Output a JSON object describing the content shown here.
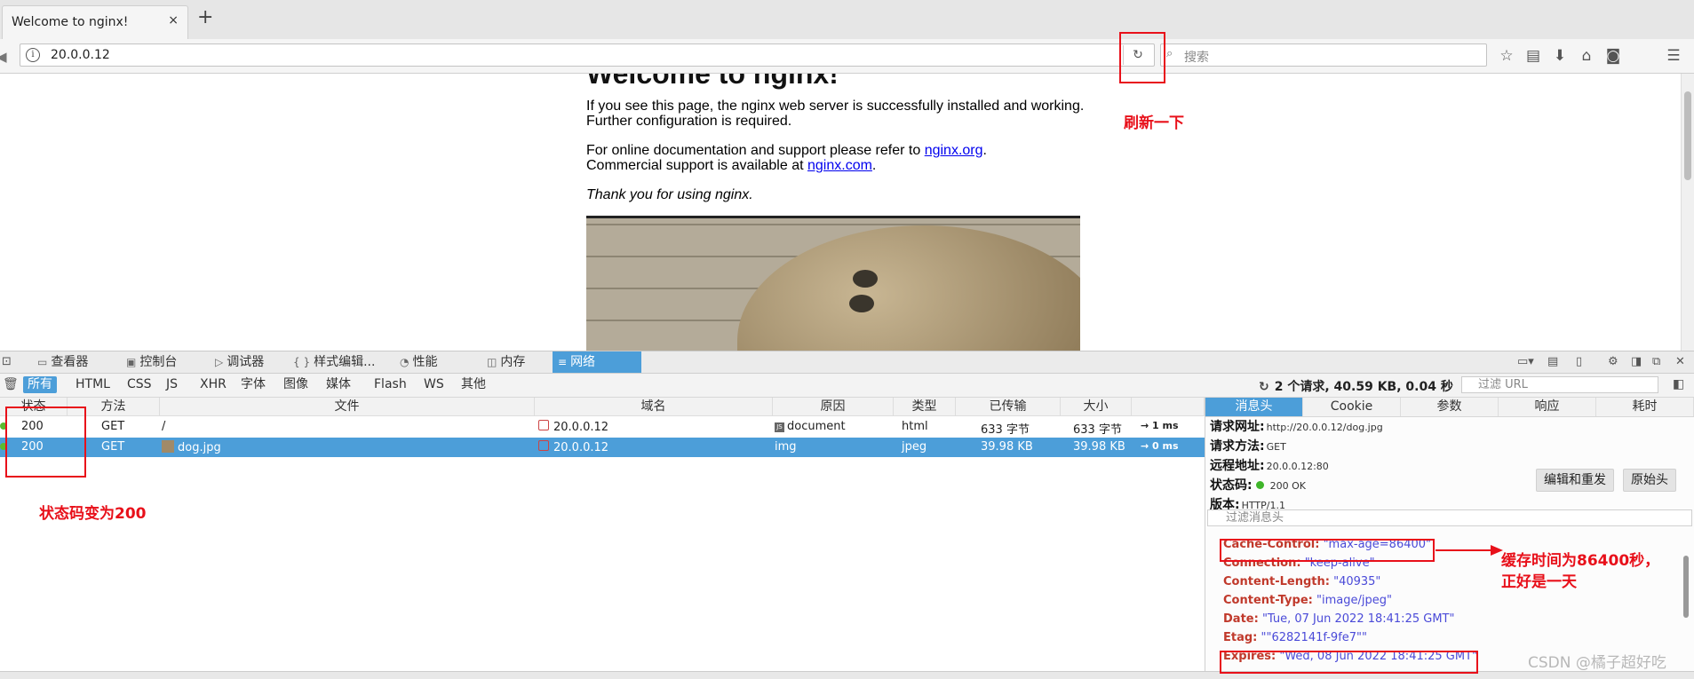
{
  "browser": {
    "tab_title": "Welcome to nginx!",
    "tab_close": "×",
    "new_tab": "+",
    "url": "20.0.0.12",
    "search_placeholder": "搜索"
  },
  "page": {
    "heading": "Welcome to nginx!",
    "p1_line1": "If you see this page, the nginx web server is successfully installed and working.",
    "p1_line2": "Further configuration is required.",
    "p2_prefix": "For online documentation and support please refer to ",
    "p2_link": "nginx.org",
    "p2_suffix": ".",
    "p3_prefix": "Commercial support is available at ",
    "p3_link": "nginx.com",
    "p3_suffix": ".",
    "thanks": "Thank you for using nginx."
  },
  "devtools": {
    "tabs": [
      "查看器",
      "控制台",
      "调试器",
      "样式编辑...",
      "性能",
      "内存",
      "网络"
    ],
    "active_tab": "网络",
    "filters": [
      "所有",
      "HTML",
      "CSS",
      "JS",
      "XHR",
      "字体",
      "图像",
      "媒体",
      "Flash",
      "WS",
      "其他"
    ],
    "active_filter": "所有",
    "summary": "2 个请求, 40.59 KB, 0.04 秒",
    "url_filter_placeholder": "过滤 URL",
    "columns": [
      "状态",
      "方法",
      "文件",
      "域名",
      "原因",
      "类型",
      "已传输",
      "大小"
    ],
    "requests": [
      {
        "status": "200",
        "method": "GET",
        "file": "/",
        "domain": "20.0.0.12",
        "cause": "document",
        "type": "html",
        "transferred": "633 字节",
        "size": "633 字节",
        "timing": "→ 1 ms"
      },
      {
        "status": "200",
        "method": "GET",
        "file": "dog.jpg",
        "domain": "20.0.0.12",
        "cause": "img",
        "type": "jpeg",
        "transferred": "39.98 KB",
        "size": "39.98 KB",
        "timing": "→ 0 ms"
      }
    ],
    "side_tabs": [
      "消息头",
      "Cookie",
      "参数",
      "响应",
      "耗时"
    ],
    "active_side_tab": "消息头",
    "request_url_label": "请求网址:",
    "request_url": "http://20.0.0.12/dog.jpg",
    "request_method_label": "请求方法:",
    "request_method": "GET",
    "remote_addr_label": "远程地址:",
    "remote_addr": "20.0.0.12:80",
    "status_code_label": "状态码:",
    "status_code": "200 OK",
    "version_label": "版本:",
    "version": "HTTP/1.1",
    "edit_resend": "编辑和重发",
    "raw_headers": "原始头",
    "header_filter_placeholder": "过滤消息头",
    "headers": [
      {
        "name": "Cache-Control:",
        "value": "\"max-age=86400\""
      },
      {
        "name": "Connection:",
        "value": "\"keep-alive\""
      },
      {
        "name": "Content-Length:",
        "value": "\"40935\""
      },
      {
        "name": "Content-Type:",
        "value": "\"image/jpeg\""
      },
      {
        "name": "Date:",
        "value": "\"Tue, 07 Jun 2022 18:41:25 GMT\""
      },
      {
        "name": "Etag:",
        "value": "\"\"6282141f-9fe7\"\""
      },
      {
        "name": "Expires:",
        "value": "\"Wed, 08 Jun 2022 18:41:25 GMT\""
      }
    ]
  },
  "annotations": {
    "refresh": "刷新一下",
    "status_changed": "状态码变为200",
    "cache_line1": "缓存时间为86400秒，",
    "cache_line2": "正好是一天",
    "accent_color": "#e8101a"
  },
  "watermark": "CSDN @橘子超好吃"
}
